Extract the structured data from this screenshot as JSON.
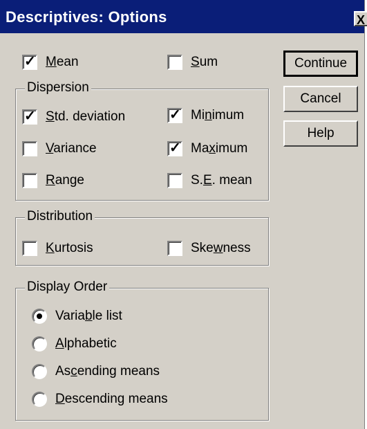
{
  "dialog": {
    "title": "Descriptives: Options",
    "close_label": "X"
  },
  "checks": {
    "mean": {
      "pre": "",
      "ul": "M",
      "post": "ean",
      "checked": true
    },
    "sum": {
      "pre": "",
      "ul": "S",
      "post": "um",
      "checked": false
    }
  },
  "dispersion": {
    "label": "Dispersion",
    "std_deviation": {
      "pre": "",
      "ul": "S",
      "post": "td. deviation",
      "checked": true
    },
    "minimum": {
      "pre": "Mi",
      "ul": "n",
      "post": "imum",
      "checked": true
    },
    "variance": {
      "pre": "",
      "ul": "V",
      "post": "ariance",
      "checked": false
    },
    "maximum": {
      "pre": "Ma",
      "ul": "x",
      "post": "imum",
      "checked": true
    },
    "range": {
      "pre": "",
      "ul": "R",
      "post": "ange",
      "checked": false
    },
    "se_mean": {
      "pre": "S.",
      "ul": "E",
      "post": ". mean",
      "checked": false
    }
  },
  "distribution": {
    "label": "Distribution",
    "kurtosis": {
      "pre": "",
      "ul": "K",
      "post": "urtosis",
      "checked": false
    },
    "skewness": {
      "pre": "Ske",
      "ul": "w",
      "post": "ness",
      "checked": false
    }
  },
  "display_order": {
    "label": "Display Order",
    "selected": "variable_list",
    "options": {
      "variable_list": {
        "pre": "Varia",
        "ul": "b",
        "post": "le list"
      },
      "alphabetic": {
        "pre": "",
        "ul": "A",
        "post": "lphabetic"
      },
      "ascending": {
        "pre": "As",
        "ul": "c",
        "post": "ending means"
      },
      "descending": {
        "pre": "",
        "ul": "D",
        "post": "escending means"
      }
    }
  },
  "buttons": {
    "continue": "Continue",
    "cancel": "Cancel",
    "help": "Help"
  }
}
